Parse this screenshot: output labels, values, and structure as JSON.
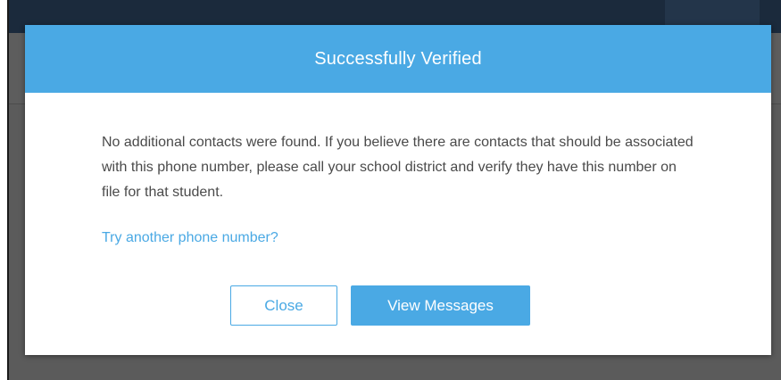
{
  "modal": {
    "title": "Successfully Verified",
    "message": "No additional contacts were found. If you believe there are contacts that should be associated with this phone number, please call your school district and verify they have this number on file for that student.",
    "link_text": "Try another phone number?",
    "close_label": "Close",
    "view_messages_label": "View Messages"
  },
  "colors": {
    "accent": "#4aa9e4",
    "topbar": "#1b2a3c",
    "backdrop": "#5b5b5b",
    "text": "#4a4a4a"
  }
}
